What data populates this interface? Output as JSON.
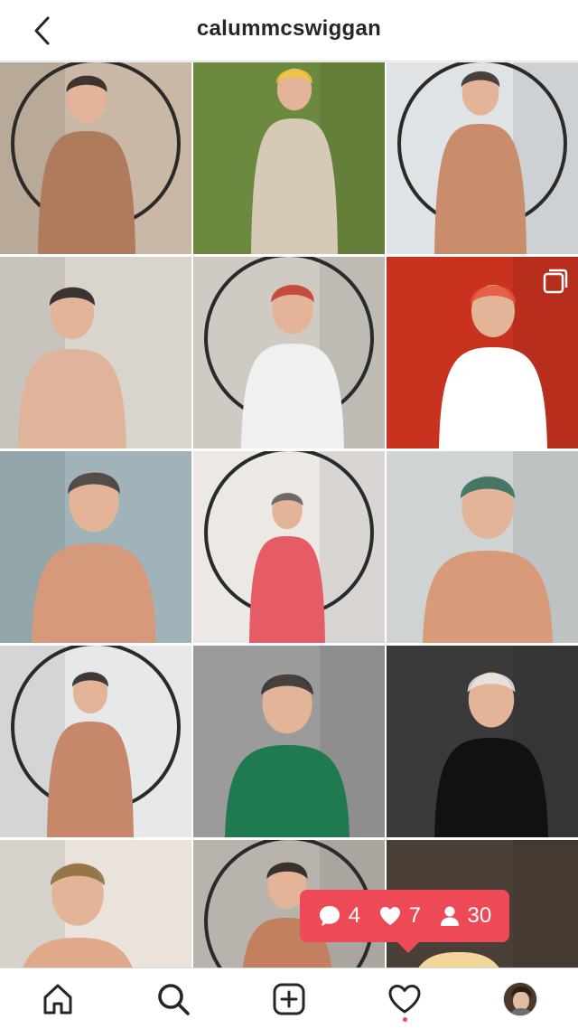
{
  "header": {
    "back_icon": "chevron-left-icon",
    "username": "calummcswiggan"
  },
  "grid": {
    "tiles": [
      {
        "name": "post-1",
        "bg": "#c9b8a6",
        "fg": "#b07a5c",
        "accent": "#1f1f1f",
        "kind": "mirror-selfie-desk"
      },
      {
        "name": "post-2",
        "bg": "#6c8a3f",
        "fg": "#d6c9b5",
        "accent": "#f2c23a",
        "kind": "running-stairs"
      },
      {
        "name": "post-3",
        "bg": "#dfe3e6",
        "fg": "#c98d6c",
        "accent": "#2b2b2b",
        "kind": "round-mirror"
      },
      {
        "name": "post-4",
        "bg": "#d9d4cc",
        "fg": "#e0b49a",
        "accent": "#1c1c1c",
        "kind": "phone-holding"
      },
      {
        "name": "post-5",
        "bg": "#cfcac4",
        "fg": "#f0f0f0",
        "accent": "#c0392b",
        "kind": "mirror-white-tank"
      },
      {
        "name": "post-6",
        "bg": "#c8321f",
        "fg": "#ffffff",
        "accent": "#e5533a",
        "kind": "red-room",
        "multi": true
      },
      {
        "name": "post-7",
        "bg": "#9fb3b8",
        "fg": "#d59a7c",
        "accent": "#3a3a3a",
        "kind": "lying-pillow"
      },
      {
        "name": "post-8",
        "bg": "#ece8e4",
        "fg": "#e55b66",
        "accent": "#5a5a5a",
        "kind": "hallway-mirror"
      },
      {
        "name": "post-9",
        "bg": "#cfd3d4",
        "fg": "#d89a79",
        "accent": "#2a6c5a",
        "kind": "shirtless-selfie"
      },
      {
        "name": "post-10",
        "bg": "#e6e8ea",
        "fg": "#c6876a",
        "accent": "#222222",
        "kind": "round-mirror-room"
      },
      {
        "name": "post-11",
        "bg": "#9b9b9b",
        "fg": "#1f7a52",
        "accent": "#2b2b2b",
        "kind": "green-tee"
      },
      {
        "name": "post-12",
        "bg": "#3a3a3a",
        "fg": "#111111",
        "accent": "#e8e8e8",
        "kind": "snow-scene"
      },
      {
        "name": "post-13",
        "bg": "#e9e3dc",
        "fg": "#e0a98b",
        "accent": "#8a6a3a",
        "kind": "messy-hair"
      },
      {
        "name": "post-14",
        "bg": "#b9b3ad",
        "fg": "#c2805f",
        "accent": "#1a1a1a",
        "kind": "gym-mirror"
      },
      {
        "name": "post-15",
        "bg": "#4a3f36",
        "fg": "#f2d59a",
        "accent": "#c93f2b",
        "kind": "christmas-mum"
      }
    ]
  },
  "activity_tooltip": {
    "comments_icon": "comment-bubble-icon",
    "comments_count": "4",
    "likes_icon": "heart-icon",
    "likes_count": "7",
    "followers_icon": "person-icon",
    "followers_count": "30"
  },
  "tabbar": {
    "items": [
      {
        "name": "tab-home",
        "icon": "home-icon"
      },
      {
        "name": "tab-search",
        "icon": "search-icon"
      },
      {
        "name": "tab-add",
        "icon": "add-post-icon"
      },
      {
        "name": "tab-activity",
        "icon": "heart-icon"
      },
      {
        "name": "tab-profile",
        "icon": "avatar"
      }
    ]
  },
  "colors": {
    "accent": "#ed4956",
    "border": "#dbdbdb",
    "text": "#262626"
  }
}
